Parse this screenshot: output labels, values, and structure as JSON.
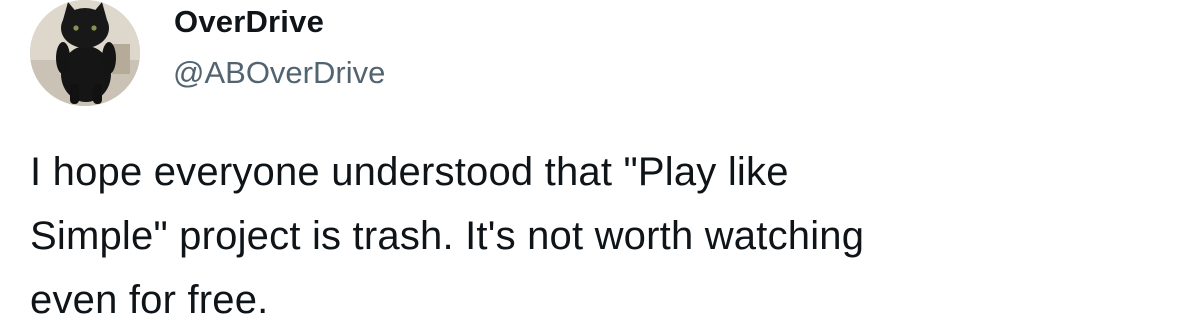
{
  "tweet": {
    "display_name": "OverDrive",
    "handle": "@ABOverDrive",
    "text": "I hope everyone understood that \"Play like\nSimple\" project is trash. It's not worth watching\neven for free.",
    "avatar_icon": "black-cat-avatar"
  }
}
